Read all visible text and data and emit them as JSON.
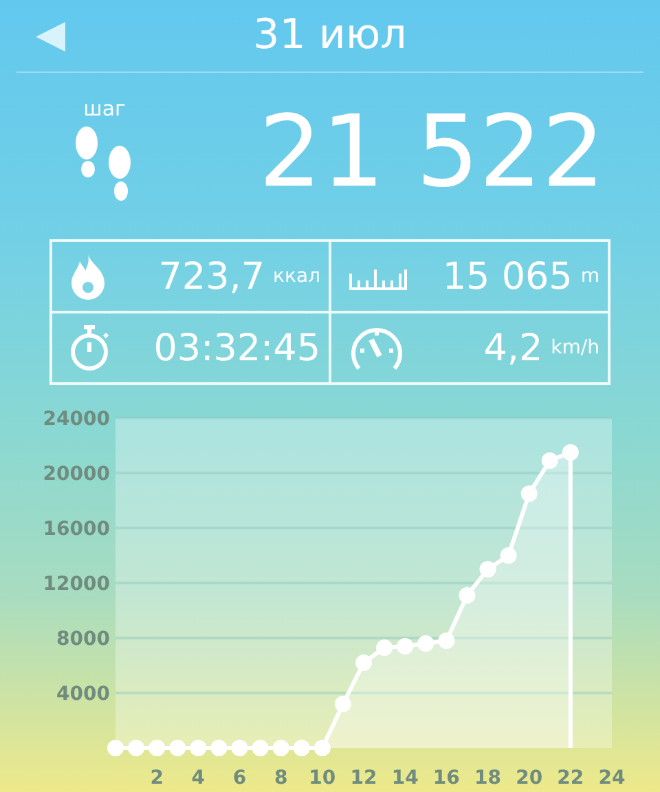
{
  "header": {
    "back": "◀",
    "title": "31 июл"
  },
  "steps": {
    "label": "шаг",
    "count": "21 522"
  },
  "stats": [
    {
      "kind": "calories",
      "value": "723,7",
      "unit": "ккал"
    },
    {
      "kind": "distance",
      "value": "15 065",
      "unit": "m"
    },
    {
      "kind": "duration",
      "value": "03:32:45"
    },
    {
      "kind": "speed",
      "value": "4,2",
      "unit": "km/h"
    }
  ],
  "chart": {
    "chart_data": {
      "type": "area",
      "x": [
        0,
        1,
        2,
        3,
        4,
        5,
        6,
        7,
        8,
        9,
        10,
        11,
        12,
        13,
        14,
        15,
        16,
        17,
        18,
        19,
        20,
        21,
        22
      ],
      "series": [
        {
          "color": "#ffffff",
          "values": [
            0,
            0,
            0,
            0,
            0,
            0,
            0,
            0,
            0,
            0,
            0,
            3200,
            6200,
            7300,
            7400,
            7600,
            7800,
            11100,
            13000,
            14000,
            18500,
            20900,
            21500
          ]
        }
      ],
      "grid": true,
      "xlim": [
        0,
        24
      ],
      "ylim": [
        0,
        24000
      ],
      "xticks": [
        2,
        4,
        6,
        8,
        10,
        12,
        14,
        16,
        18,
        20,
        22,
        24
      ],
      "yticks": [
        4000,
        8000,
        12000,
        16000,
        20000,
        24000
      ]
    }
  }
}
